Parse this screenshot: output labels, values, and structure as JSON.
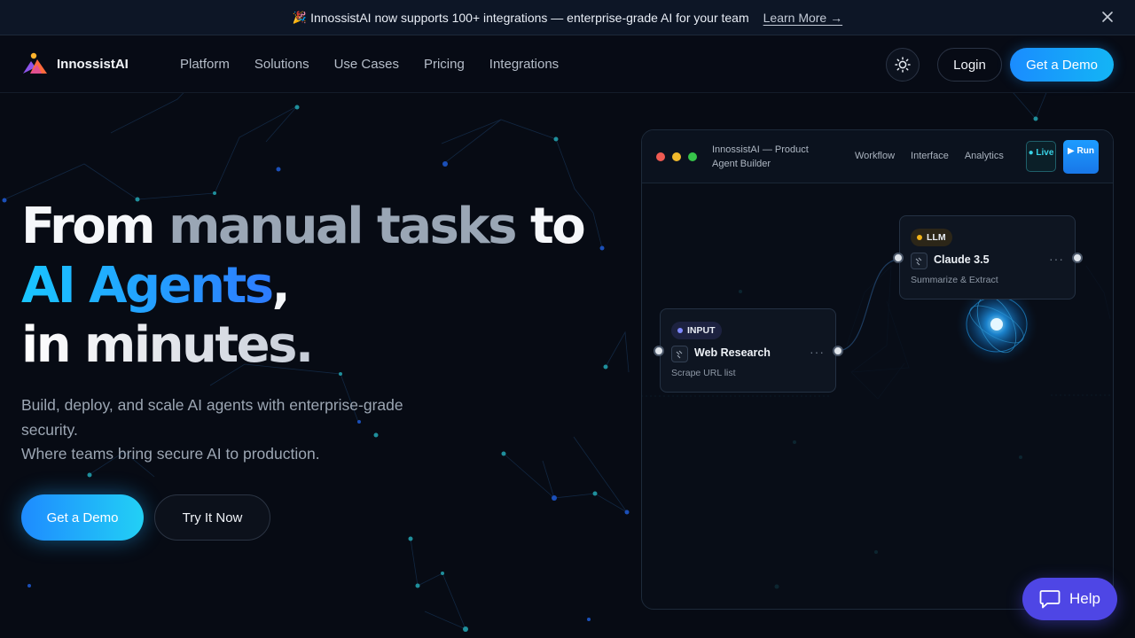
{
  "announcement": {
    "icon": "party-popper-icon",
    "text": "InnossistAI now supports 100+ integrations — enterprise-grade AI for your team",
    "link": "Learn More →"
  },
  "nav": {
    "brand": "InnossistAI",
    "links": [
      "Platform",
      "Solutions",
      "Use Cases",
      "Pricing",
      "Integrations"
    ],
    "login": "Login",
    "demo": "Get a Demo"
  },
  "hero": {
    "title_from": "From",
    "title_manual": "manual tasks",
    "title_to": "to",
    "title_agents": "AI Agents",
    "title_comma": ",",
    "title_minutes": "in minutes.",
    "subtitle_line1": "Build, deploy, and scale AI agents with enterprise-grade security.",
    "subtitle_line2": "Where teams bring secure AI to production.",
    "cta_primary": "Get a Demo",
    "cta_secondary": "Try It Now"
  },
  "builder": {
    "title": "InnossistAI — Product Agent Builder",
    "tabs": [
      "Workflow",
      "Interface",
      "Analytics"
    ],
    "live": "● Live",
    "run": "▶ Run",
    "nodes": {
      "input": {
        "tag": "INPUT",
        "name": "Web Research",
        "desc": "Scrape URL list",
        "more": "···"
      },
      "llm": {
        "tag": "LLM",
        "name": "Claude 3.5",
        "desc": "Summarize & Extract",
        "more": "···"
      }
    }
  },
  "help": {
    "label": "Help"
  },
  "colors": {
    "background": "#070b14",
    "accent_cyan": "#19c6ff",
    "accent_blue": "#1a8cff",
    "help_purple": "#4e46e5",
    "input_dot": "#7f89ff",
    "llm_dot": "#f3b317"
  }
}
